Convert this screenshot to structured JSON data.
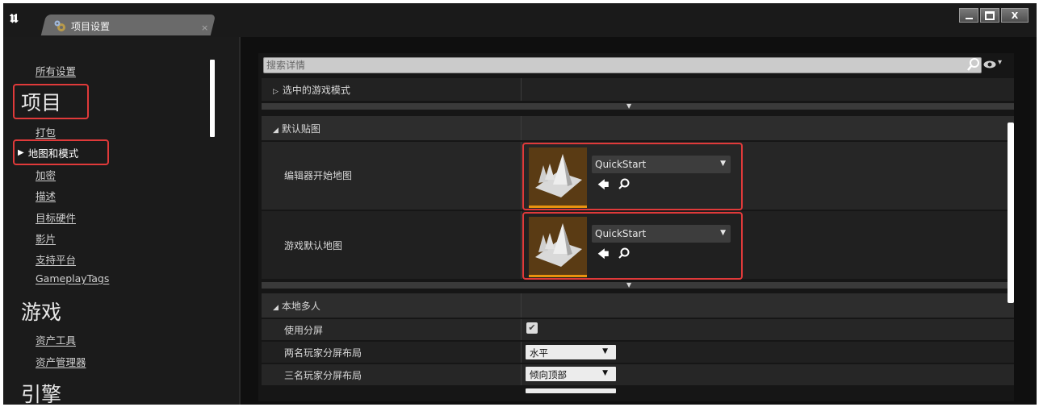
{
  "window": {
    "tab_title": "项目设置",
    "close_glyph": "×",
    "buttons": [
      "minimize",
      "maximize",
      "close"
    ],
    "close_label": "X"
  },
  "sidebar": {
    "all_settings": "所有设置",
    "section_project": "项目",
    "project_items": [
      "打包",
      "地图和模式",
      "加密",
      "描述",
      "目标硬件",
      "影片",
      "支持平台",
      "GameplayTags"
    ],
    "active_item": "地图和模式",
    "section_game": "游戏",
    "game_items": [
      "资产工具",
      "资产管理器"
    ],
    "section_engine": "引擎"
  },
  "search": {
    "placeholder": "搜索详情"
  },
  "details": {
    "selected_game_mode": "选中的游戏模式",
    "default_maps": "默认贴图",
    "editor_startup_map": {
      "label": "编辑器开始地图",
      "value": "QuickStart"
    },
    "game_default_map": {
      "label": "游戏默认地图",
      "value": "QuickStart"
    },
    "local_multiplayer": "本地多人",
    "use_splitscreen": {
      "label": "使用分屏",
      "checked": true
    },
    "two_player_layout": {
      "label": "两名玩家分屏布局",
      "value": "水平"
    },
    "three_player_layout": {
      "label": "三名玩家分屏布局",
      "value": "倾向顶部"
    }
  },
  "colors": {
    "highlight": "#e03a3a",
    "thumb_bar": "#e8930f"
  },
  "icons": [
    "ue-logo",
    "gear-icon",
    "search-icon",
    "eye-icon",
    "arrow-left-icon",
    "magnifier-icon",
    "checkmark-icon"
  ]
}
